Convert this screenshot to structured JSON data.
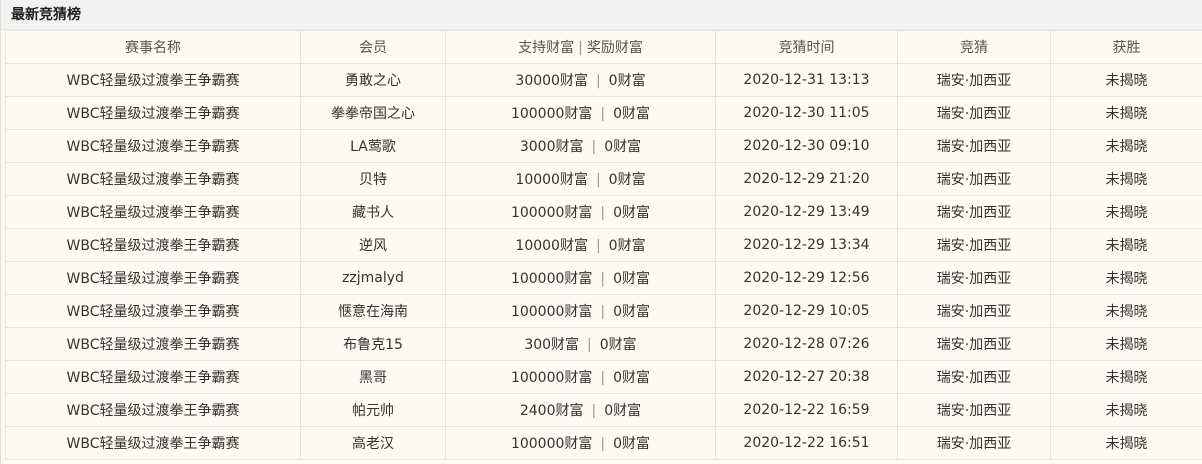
{
  "panel": {
    "title": "最新竞猜榜"
  },
  "table": {
    "headers": {
      "event": "赛事名称",
      "member": "会员",
      "support": "支持财富",
      "reward": "奖励财富",
      "time": "竞猜时间",
      "pick": "竞猜",
      "winner": "获胜"
    },
    "rows": [
      {
        "event": "WBC轻量级过渡拳王争霸赛",
        "member": "勇敢之心",
        "support": "30000财富",
        "reward": "0财富",
        "time": "2020-12-31 13:13",
        "pick": "瑞安·加西亚",
        "winner": "未揭晓"
      },
      {
        "event": "WBC轻量级过渡拳王争霸赛",
        "member": "拳拳帝国之心",
        "support": "100000财富",
        "reward": "0财富",
        "time": "2020-12-30 11:05",
        "pick": "瑞安·加西亚",
        "winner": "未揭晓"
      },
      {
        "event": "WBC轻量级过渡拳王争霸赛",
        "member": "LA莺歌",
        "support": "3000财富",
        "reward": "0财富",
        "time": "2020-12-30 09:10",
        "pick": "瑞安·加西亚",
        "winner": "未揭晓"
      },
      {
        "event": "WBC轻量级过渡拳王争霸赛",
        "member": "贝特",
        "support": "10000财富",
        "reward": "0财富",
        "time": "2020-12-29 21:20",
        "pick": "瑞安·加西亚",
        "winner": "未揭晓"
      },
      {
        "event": "WBC轻量级过渡拳王争霸赛",
        "member": "藏书人",
        "support": "100000财富",
        "reward": "0财富",
        "time": "2020-12-29 13:49",
        "pick": "瑞安·加西亚",
        "winner": "未揭晓"
      },
      {
        "event": "WBC轻量级过渡拳王争霸赛",
        "member": "逆风",
        "support": "10000财富",
        "reward": "0财富",
        "time": "2020-12-29 13:34",
        "pick": "瑞安·加西亚",
        "winner": "未揭晓"
      },
      {
        "event": "WBC轻量级过渡拳王争霸赛",
        "member": "zzjmalyd",
        "support": "100000财富",
        "reward": "0财富",
        "time": "2020-12-29 12:56",
        "pick": "瑞安·加西亚",
        "winner": "未揭晓"
      },
      {
        "event": "WBC轻量级过渡拳王争霸赛",
        "member": "惬意在海南",
        "support": "100000财富",
        "reward": "0财富",
        "time": "2020-12-29 10:05",
        "pick": "瑞安·加西亚",
        "winner": "未揭晓"
      },
      {
        "event": "WBC轻量级过渡拳王争霸赛",
        "member": "布鲁克15",
        "support": "300财富",
        "reward": "0财富",
        "time": "2020-12-28 07:26",
        "pick": "瑞安·加西亚",
        "winner": "未揭晓"
      },
      {
        "event": "WBC轻量级过渡拳王争霸赛",
        "member": "黑哥",
        "support": "100000财富",
        "reward": "0财富",
        "time": "2020-12-27 20:38",
        "pick": "瑞安·加西亚",
        "winner": "未揭晓"
      },
      {
        "event": "WBC轻量级过渡拳王争霸赛",
        "member": "帕元帅",
        "support": "2400财富",
        "reward": "0财富",
        "time": "2020-12-22 16:59",
        "pick": "瑞安·加西亚",
        "winner": "未揭晓"
      },
      {
        "event": "WBC轻量级过渡拳王争霸赛",
        "member": "高老汉",
        "support": "100000财富",
        "reward": "0财富",
        "time": "2020-12-22 16:51",
        "pick": "瑞安·加西亚",
        "winner": "未揭晓"
      }
    ]
  },
  "colors": {
    "panel_bg": "#fcfaf2",
    "title_bg": "#f2f2f2",
    "border": "#e8e3d6"
  }
}
